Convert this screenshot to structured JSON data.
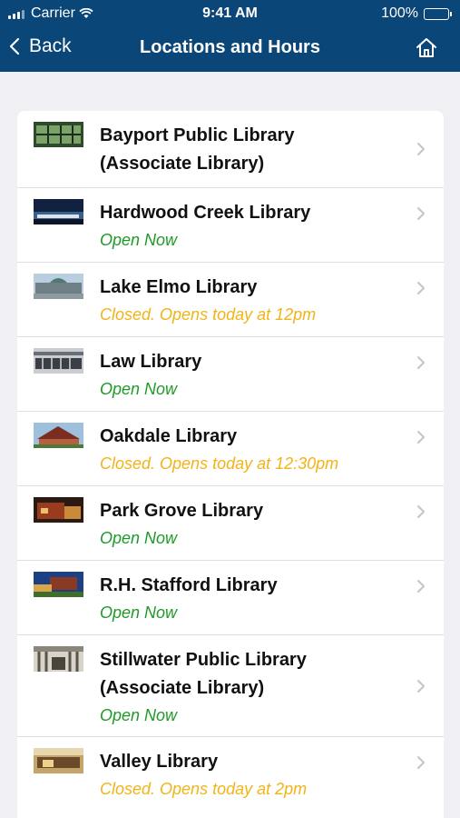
{
  "status_bar": {
    "carrier": "Carrier",
    "time": "9:41 AM",
    "battery": "100%"
  },
  "nav": {
    "back_label": "Back",
    "title": "Locations and Hours"
  },
  "colors": {
    "header": "#0b4679",
    "open": "#1f9a2a",
    "closed": "#f2b318"
  },
  "libraries": [
    {
      "name_line1": "Bayport Public Library",
      "name_line2": "(Associate Library)",
      "status": ""
    },
    {
      "name_line1": "Hardwood Creek Library",
      "name_line2": "",
      "status": "Open Now"
    },
    {
      "name_line1": "Lake Elmo Library",
      "name_line2": "",
      "status": "Closed. Opens today at 12pm"
    },
    {
      "name_line1": "Law Library",
      "name_line2": "",
      "status": "Open Now"
    },
    {
      "name_line1": "Oakdale Library",
      "name_line2": "",
      "status": "Closed. Opens today at 12:30pm"
    },
    {
      "name_line1": "Park Grove Library",
      "name_line2": "",
      "status": "Open Now"
    },
    {
      "name_line1": "R.H. Stafford Library",
      "name_line2": "",
      "status": "Open Now"
    },
    {
      "name_line1": "Stillwater Public Library",
      "name_line2": "(Associate Library)",
      "status": "Open Now"
    },
    {
      "name_line1": "Valley Library",
      "name_line2": "",
      "status": "Closed. Opens today at 2pm"
    }
  ]
}
